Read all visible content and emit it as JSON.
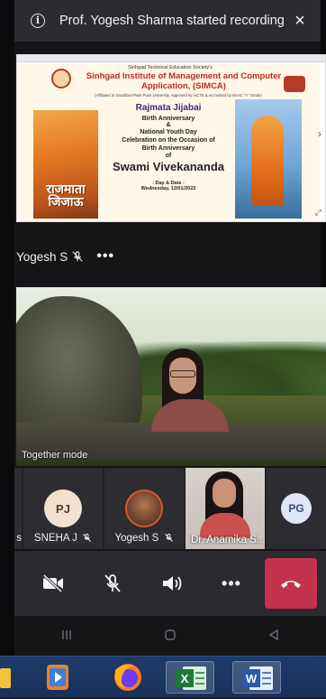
{
  "notification": {
    "text": "Prof. Yogesh Sharma started recording",
    "info_icon": "i",
    "close_icon": "×"
  },
  "shared_screen": {
    "org_line": "Sinhgad Technical Education Society's",
    "institute": "Sinhgad Institute of Management and Computer Application, (SIMCA)",
    "affiliation": "(Affiliated to Savitribai Phule Pune University, Approved by AICTE & Accredited by NAAC \"A\" Grade)",
    "title_line1": "Rajmata Jijabai",
    "title_line2": "Birth Anniversary",
    "amp": "&",
    "title_line3": "National Youth Day",
    "title_line4": "Celebration on the Occasion of",
    "title_line5": "Birth Anniversary",
    "of": "of",
    "swami": "Swami Vivekananda",
    "day_label": ": Day & Date :",
    "date": "Wednesday, 12/01/2022",
    "left_caption": "राजमाता जिजाऊ"
  },
  "presenter": {
    "name": "Yogesh S",
    "more": "•••"
  },
  "together_mode": {
    "label": "Together mode"
  },
  "participants": [
    {
      "initials": "PJ",
      "name": "SNEHA J",
      "muted": true
    },
    {
      "initials": "",
      "name": "Yogesh S",
      "muted": true
    },
    {
      "initials": "",
      "name": "Dr. Anamika S...",
      "muted": false
    },
    {
      "initials": "PG",
      "name": "",
      "muted": false
    }
  ],
  "partial_tile_name": "s",
  "controls": {
    "camera": "camera-off-icon",
    "mic": "mic-off-icon",
    "speaker": "speaker-icon",
    "more": "•••",
    "hangup": "hang-up-icon"
  },
  "navbar": {
    "recents": "|||",
    "home": "○",
    "back": "◁"
  },
  "colors": {
    "banner_bg": "#2b2b31",
    "app_bg": "#151518",
    "hangup": "#c4314b",
    "avatar_pj": "#f3e1cf",
    "avatar_pg": "#dfe6f6",
    "taskbar": "#1f3b6b"
  }
}
